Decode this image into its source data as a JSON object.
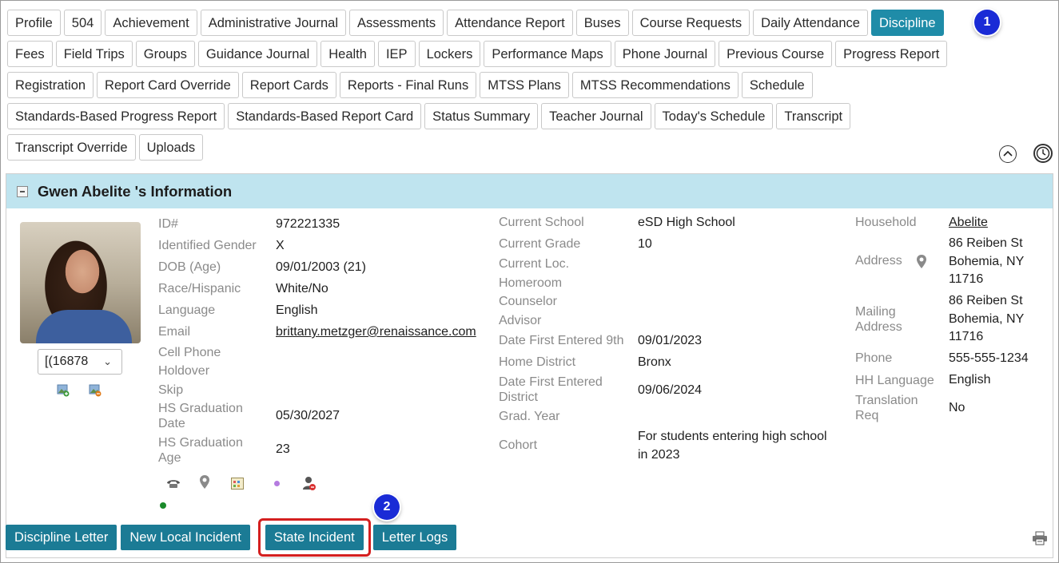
{
  "tabs": {
    "row1": [
      "Profile",
      "504",
      "Achievement",
      "Administrative Journal",
      "Assessments",
      "Attendance Report",
      "Buses",
      "Course Requests",
      "Daily Attendance",
      "Discipline"
    ],
    "row2": [
      "Fees",
      "Field Trips",
      "Groups",
      "Guidance Journal",
      "Health",
      "IEP",
      "Lockers",
      "Performance Maps",
      "Phone Journal",
      "Previous Course",
      "Progress Report"
    ],
    "row3": [
      "Registration",
      "Report Card Override",
      "Report Cards",
      "Reports - Final Runs",
      "MTSS Plans",
      "MTSS Recommendations",
      "Schedule"
    ],
    "row4": [
      "Standards-Based Progress Report",
      "Standards-Based Report Card",
      "Status Summary",
      "Teacher Journal",
      "Today's Schedule",
      "Transcript"
    ],
    "row5": [
      "Transcript Override",
      "Uploads"
    ],
    "active": "Discipline"
  },
  "callouts": {
    "one": "1",
    "two": "2"
  },
  "panel": {
    "title": "Gwen Abelite 's Information",
    "id_select": "[(16878"
  },
  "student": {
    "id_label": "ID#",
    "id_value": "972221335",
    "gender_label": "Identified Gender",
    "gender_value": "X",
    "dob_label": "DOB (Age)",
    "dob_value": "09/01/2003 (21)",
    "race_label": "Race/Hispanic",
    "race_value": "White/No",
    "language_label": "Language",
    "language_value": "English",
    "email_label": "Email",
    "email_value": "brittany.metzger@renaissance.com",
    "cell_label": "Cell Phone",
    "holdover_label": "Holdover",
    "skip_label": "Skip",
    "hs_grad_date_label_1": "HS Graduation",
    "hs_grad_date_label_2": "Date",
    "hs_grad_date_value": "05/30/2027",
    "hs_grad_age_label_1": "HS Graduation",
    "hs_grad_age_label_2": "Age",
    "hs_grad_age_value": "23"
  },
  "school": {
    "current_school_label": "Current School",
    "current_school_value": "eSD High School",
    "current_grade_label": "Current Grade",
    "current_grade_value": "10",
    "current_loc_label": "Current Loc.",
    "homeroom_label": "Homeroom",
    "counselor_label": "Counselor",
    "advisor_label": "Advisor",
    "first_9th_label": "Date First Entered 9th",
    "first_9th_value": "09/01/2023",
    "home_district_label": "Home District",
    "home_district_value": "Bronx",
    "first_district_label_1": "Date First Entered",
    "first_district_label_2": "District",
    "first_district_value": "09/06/2024",
    "grad_year_label": "Grad. Year",
    "cohort_label": "Cohort",
    "cohort_value_1": "For students entering high school",
    "cohort_value_2": "in 2023"
  },
  "household": {
    "household_label": "Household",
    "household_value": "Abelite",
    "address_label": "Address",
    "address_1": "86 Reiben St",
    "address_2": "Bohemia, NY",
    "address_3": "11716",
    "mailing_label_1": "Mailing",
    "mailing_label_2": "Address",
    "mailing_1": "86 Reiben St",
    "mailing_2": "Bohemia, NY",
    "mailing_3": "11716",
    "phone_label": "Phone",
    "phone_value": "555-555-1234",
    "hh_language_label": "HH Language",
    "hh_language_value": "English",
    "translation_label_1": "Translation",
    "translation_label_2": "Req",
    "translation_value": "No"
  },
  "actions": [
    "Discipline Letter",
    "New Local Incident",
    "State Incident",
    "Letter Logs"
  ],
  "colors": {
    "active_tab": "#1f8ca8",
    "action_button": "#1b7b95",
    "header_bg": "#bfe4ef",
    "highlight": "#d41f1f",
    "callout": "#1a2bd6"
  }
}
